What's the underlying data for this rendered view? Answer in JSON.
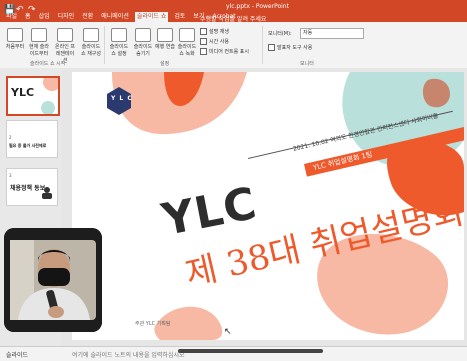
{
  "titlebar": {
    "quick_access": [
      "💾",
      "↶",
      "↷"
    ],
    "title": "ylc.pptx - PowerPoint",
    "tabs": [
      "파일",
      "홈",
      "삽입",
      "디자인",
      "전환",
      "애니메이션",
      "슬라이드 쇼",
      "검토",
      "보기",
      "Acrobat"
    ],
    "active_tab_index": 6,
    "tell_me": "수행할 작업을 알려 주세요"
  },
  "ribbon": {
    "buttons": [
      {
        "label": "처음부터",
        "icon": "play-icon"
      },
      {
        "label": "현재 슬라이드부터",
        "icon": "play-current-icon"
      },
      {
        "label": "온라인 프레젠테이션",
        "icon": "online-present-icon"
      },
      {
        "label": "슬라이드 쇼 재구성",
        "icon": "custom-show-icon"
      },
      {
        "label": "슬라이드 쇼 설정",
        "icon": "setup-icon"
      },
      {
        "label": "슬라이드 숨기기",
        "icon": "hide-slide-icon"
      },
      {
        "label": "예행 연습",
        "icon": "rehearse-icon"
      },
      {
        "label": "슬라이드 쇼 녹화",
        "icon": "record-icon"
      }
    ],
    "checkboxes": [
      "설명 재생",
      "시간 사용",
      "미디어 컨트롤 표시"
    ],
    "monitor_label": "모니터(M):",
    "monitor_value": "자동",
    "presenter_view_label": "발표자 도구 사용",
    "groups": [
      "슬라이드 쇼 시작",
      "설정",
      "모니터"
    ]
  },
  "thumbnails": [
    {
      "number": "",
      "title": "YLC",
      "selected": true
    },
    {
      "number": "2",
      "title": "필요 증 몰가 사전에로",
      "selected": false
    },
    {
      "number": "3",
      "title": "채용정책 동보",
      "selected": false
    }
  ],
  "slide": {
    "date_line": "2021. 10.02  여의도 한경연합관 컨퍼런스센터  사회이버홀",
    "badge": "YLC 취업설명회 1팀",
    "headline": "YLC",
    "script_title": "제 38대 취업설명회",
    "logo_text": "Y L C",
    "footer": "주관 YLC 기획팀"
  },
  "notes": {
    "slide_number": "슬라이드",
    "placeholder": "여기에 슬라이드 노트의 내용을 입력하십시오"
  },
  "colors": {
    "accent": "#d24726",
    "orange": "#ef5a2c",
    "peach": "#f7b9a3",
    "mint": "#b9e0da",
    "navy": "#2b3a6e"
  }
}
